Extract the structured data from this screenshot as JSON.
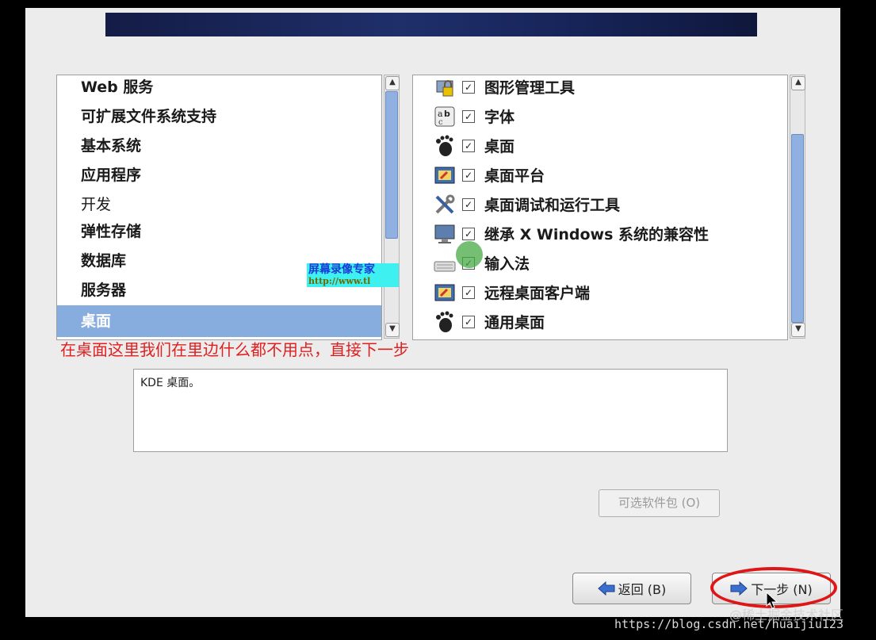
{
  "groups": [
    {
      "label": "Web 服务"
    },
    {
      "label": "可扩展文件系统支持"
    },
    {
      "label": "基本系统"
    },
    {
      "label": "应用程序"
    },
    {
      "label": "开发"
    },
    {
      "label": "弹性存储"
    },
    {
      "label": "数据库"
    },
    {
      "label": "服务器"
    },
    {
      "label": "桌面",
      "selected": true
    }
  ],
  "packages": [
    {
      "label": "图形管理工具",
      "icon": "lock-icon",
      "checked": true
    },
    {
      "label": "字体",
      "icon": "font-icon",
      "checked": true
    },
    {
      "label": "桌面",
      "icon": "gnome-foot-icon",
      "checked": true
    },
    {
      "label": "桌面平台",
      "icon": "desktop-platform-icon",
      "checked": true
    },
    {
      "label": "桌面调试和运行工具",
      "icon": "tools-icon",
      "checked": true
    },
    {
      "label": "继承 X Windows 系统的兼容性",
      "icon": "monitor-icon",
      "checked": true
    },
    {
      "label": "输入法",
      "icon": "keyboard-icon",
      "checked": true
    },
    {
      "label": "远程桌面客户端",
      "icon": "remote-desktop-icon",
      "checked": true
    },
    {
      "label": "通用桌面",
      "icon": "gnome-foot-icon",
      "checked": true
    }
  ],
  "description": "KDE 桌面。",
  "buttons": {
    "optional": "可选软件包 (O)",
    "back": "返回 (B)",
    "next": "下一步 (N)"
  },
  "annotation": "在桌面这里我们在里边什么都不用点，直接下一步",
  "watermark": {
    "line1": "屏幕录像专家",
    "line2": "http://www.tl"
  },
  "footer": {
    "community": "@稀土掘金技术社区",
    "url": "https://blog.csdn.net/huaijiu123"
  },
  "colors": {
    "selection": "#87acde",
    "annotation": "#e02020",
    "banner": "#1f2f6a"
  }
}
